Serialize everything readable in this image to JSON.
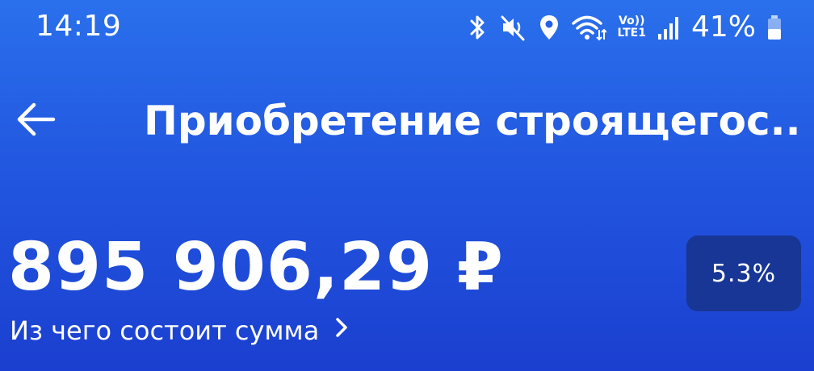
{
  "status_bar": {
    "time": "14:19",
    "lte_top": "Vo))",
    "lte_bottom": "LTE1",
    "battery_percent": "41%",
    "icons": [
      "bluetooth-icon",
      "mute-icon",
      "location-icon",
      "wifi-icon",
      "volte-icon",
      "signal-icon",
      "battery-icon"
    ]
  },
  "header": {
    "back_icon": "arrow-left-icon",
    "title": "Приобретение строящегос.."
  },
  "summary": {
    "amount": "895 906,29 ₽",
    "breakdown_link": "Из чего состоит сумма",
    "rate": "5.3%"
  },
  "colors": {
    "background_top": "#2a70ec",
    "background_bottom": "#1b3fd0",
    "badge": "#173695",
    "text": "#ffffff"
  }
}
